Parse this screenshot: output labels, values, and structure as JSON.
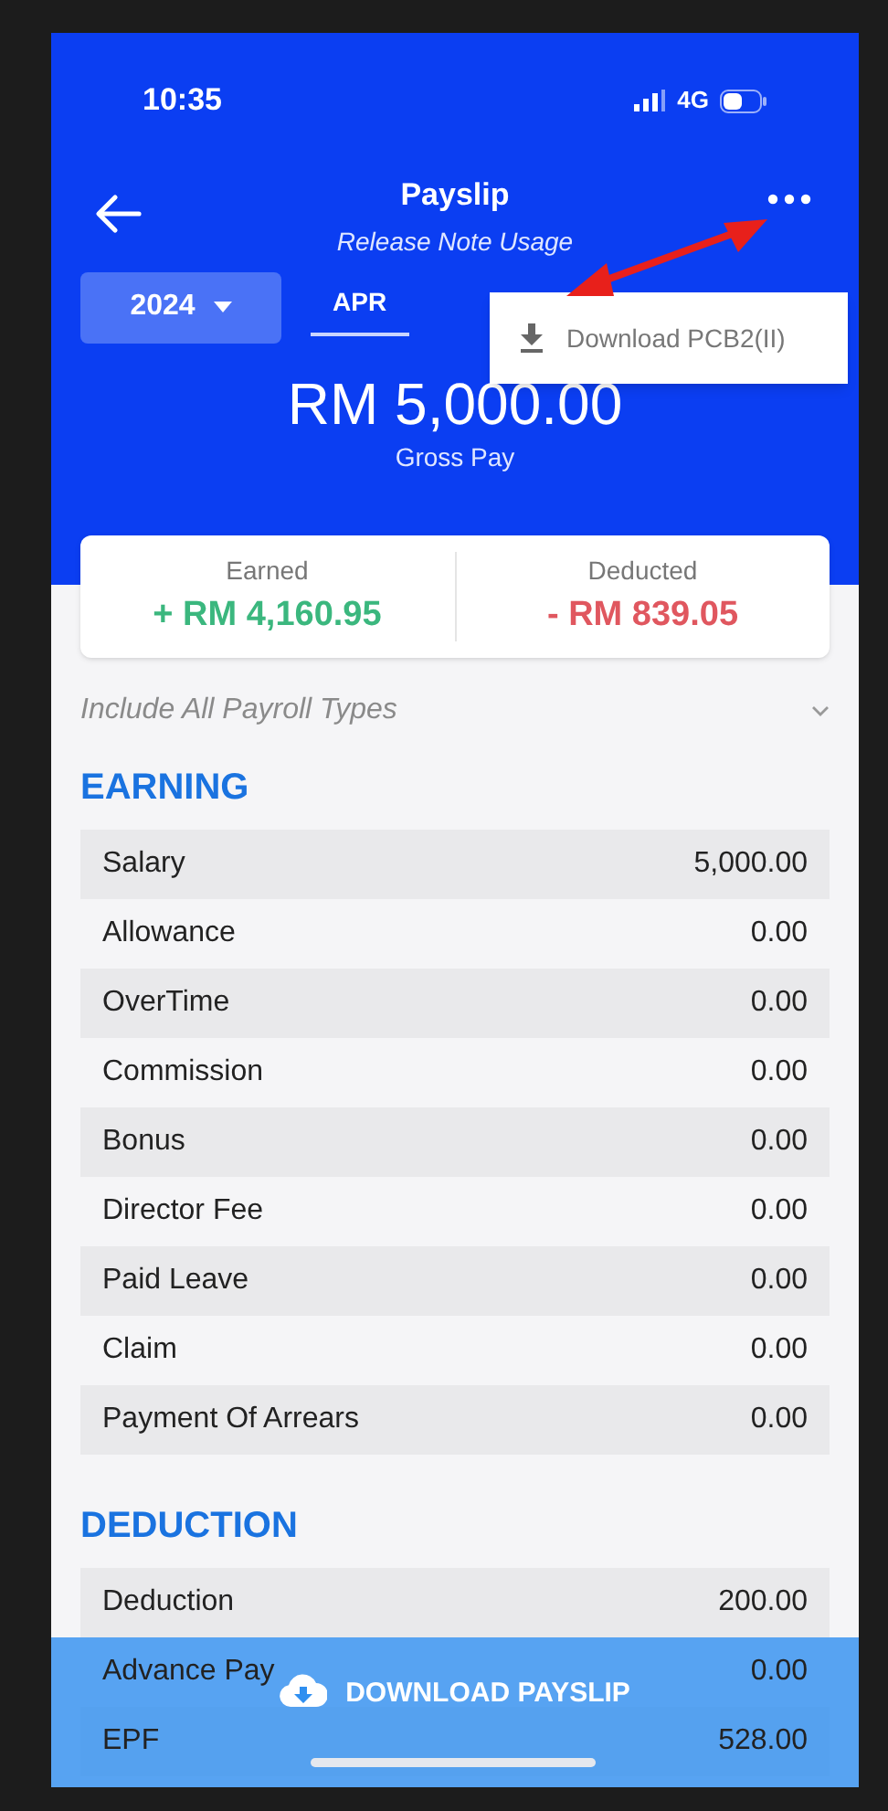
{
  "status_bar": {
    "time": "10:35",
    "network": "4G"
  },
  "header": {
    "title": "Payslip",
    "subtitle": "Release Note Usage"
  },
  "year_select": {
    "value": "2024"
  },
  "month_tabs": [
    {
      "label": "APR",
      "selected": true
    }
  ],
  "menu": {
    "items": [
      {
        "label": "Download PCB2(II)"
      }
    ]
  },
  "gross": {
    "amount": "RM 5,000.00",
    "label": "Gross Pay"
  },
  "summary": [
    {
      "kind": "earned",
      "label": "Earned",
      "value": "+ RM 4,160.95"
    },
    {
      "kind": "deducted",
      "label": "Deducted",
      "value": "- RM 839.05"
    }
  ],
  "filter": {
    "label": "Include All Payroll Types"
  },
  "sections": [
    {
      "title": "EARNING",
      "rows": [
        {
          "name": "Salary",
          "amount": "5,000.00"
        },
        {
          "name": "Allowance",
          "amount": "0.00"
        },
        {
          "name": "OverTime",
          "amount": "0.00"
        },
        {
          "name": "Commission",
          "amount": "0.00"
        },
        {
          "name": "Bonus",
          "amount": "0.00"
        },
        {
          "name": "Director Fee",
          "amount": "0.00"
        },
        {
          "name": "Paid Leave",
          "amount": "0.00"
        },
        {
          "name": "Claim",
          "amount": "0.00"
        },
        {
          "name": "Payment Of Arrears",
          "amount": "0.00"
        }
      ]
    },
    {
      "title": "DEDUCTION",
      "rows": [
        {
          "name": "Deduction",
          "amount": "200.00"
        },
        {
          "name": "Advance Pay",
          "amount": "0.00"
        },
        {
          "name": "EPF",
          "amount": "528.00"
        }
      ]
    }
  ],
  "download_button": {
    "label": "DOWNLOAD PAYSLIP"
  }
}
